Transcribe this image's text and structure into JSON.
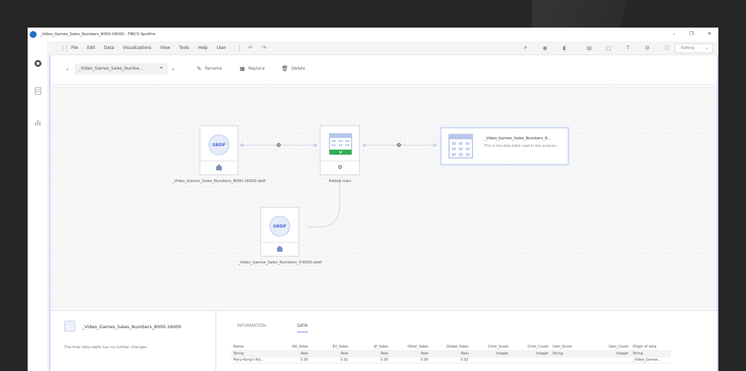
{
  "window": {
    "title": "_Video_Games_Sales_Numbers_8000-16000 - TIBCO Spotfire",
    "controls": [
      "–",
      "❐",
      "✕"
    ]
  },
  "menu": {
    "items": [
      "File",
      "Edit",
      "Data",
      "Visualizations",
      "View",
      "Tools",
      "Help",
      "User"
    ],
    "mode": "Editing"
  },
  "toolbar": {
    "current_table": "_Video_Games_Sales_Numbe...",
    "rename": "Rename",
    "replace": "Replace",
    "delete": "Delete"
  },
  "flow": {
    "source1": {
      "badge": "SBDF",
      "label": "_Video_Games_Sales_Numbers_8000-16000.sbdf"
    },
    "source2": {
      "badge": "SBDF",
      "label": "_Video_Games_Sales_Numbers_0-8000.sbdf"
    },
    "transform": {
      "label": "Added rows"
    },
    "result": {
      "title": "_Video_Games_Sales_Numbers_8...",
      "desc": "This is the data table used in the analysis."
    }
  },
  "details": {
    "title": "_Video_Games_Sales_Numbers_8000-16000",
    "desc": "The final data table has no further changes.",
    "tabs": [
      "INFORMATION",
      "DATA"
    ],
    "table": {
      "headers": [
        "Name",
        "NA_Sales",
        "EU_Sales",
        "JP_Sales",
        "Other_Sales",
        "Global_Sales",
        "Critic_Score",
        "Critic_Count",
        "User_Score",
        "User_Count",
        "Origin of data"
      ],
      "types": [
        "String",
        "Real",
        "Real",
        "Real",
        "Real",
        "Real",
        "Integer",
        "Integer",
        "String",
        "Integer",
        "String"
      ],
      "rows": [
        [
          "Mary-Kong's Rd...",
          "0.00",
          "0.02",
          "0.00",
          "0.00",
          "0.02",
          "",
          "",
          "",
          "",
          "_Video_Games..."
        ]
      ]
    }
  },
  "colors": {
    "accent": "#6f8fd8",
    "sbdf": "#4a6fd0",
    "transform_bar": "#2fae4f"
  }
}
